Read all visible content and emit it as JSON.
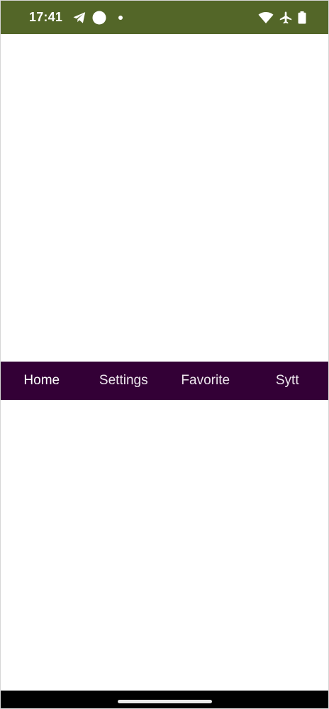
{
  "status_bar": {
    "time": "17:41",
    "background": "#536628",
    "left_icons": [
      "telegram-icon",
      "record-icon",
      "dot-icon"
    ],
    "right_icons": [
      "wifi-icon",
      "airplane-icon",
      "battery-icon"
    ]
  },
  "tabs": {
    "background": "#330036",
    "selected": "Home",
    "items": [
      {
        "label": "Home"
      },
      {
        "label": "Settings"
      },
      {
        "label": "Favorite"
      },
      {
        "label": "Sytt"
      }
    ]
  },
  "navigation_bar": {
    "background": "#000000",
    "handle": "home-handle"
  }
}
